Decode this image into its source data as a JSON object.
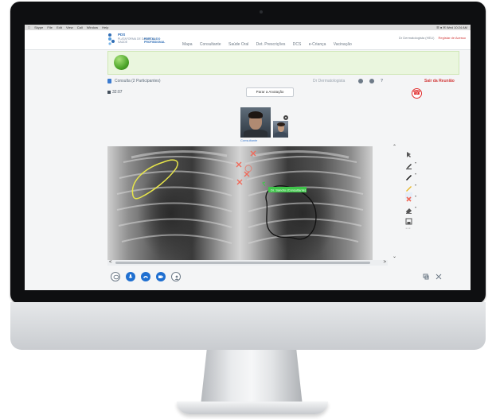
{
  "os_menubar": {
    "items": [
      "Skype",
      "File",
      "Edit",
      "View",
      "Call",
      "Window",
      "Help"
    ],
    "status_text": "☰ ● ✉ Wed 10:24 AM"
  },
  "portal": {
    "logo_text": "PDS",
    "logo_sub": "PLATAFORMA DE DADOS DA SAÚDE",
    "logo_portal": "PORTAL DO PROFISSIONAL",
    "nav_tabs": [
      "Mapa",
      "Consultante",
      "Saúde Oral",
      "Det. Prescrições",
      "DCS",
      "e-Criança",
      "Vacinação"
    ],
    "user_text": "Dr Dermatologista (HEU)",
    "logout_text": "Registar de Acesso"
  },
  "session": {
    "title": "Consulta (2 Participantes)",
    "role": "Dr Dermatologista",
    "leave_label": "Sair da Reunião",
    "timer": "32:07",
    "annotate_button": "Parar a Anotação",
    "participant_name": "Consultante"
  },
  "annotation": {
    "label_text": "Dr. Sandro (Consultante)",
    "colors": {
      "highlight": "#e8e64a",
      "cross": "#f06a5a",
      "label_bg": "#3fc54a",
      "freehand": "#111111"
    }
  },
  "icons": {
    "chat": "chat-icon",
    "hangup": "phone-hangup-icon",
    "settings": "gear-icon",
    "help": "help-icon",
    "mic": "microphone-icon",
    "phone": "phone-icon",
    "camera": "camera-icon",
    "screen": "screen-share-icon",
    "people": "people-icon"
  },
  "theme": {
    "accent": "#1f6fd0",
    "danger": "#e02c2c",
    "banner_bg": "#eaf6de"
  }
}
